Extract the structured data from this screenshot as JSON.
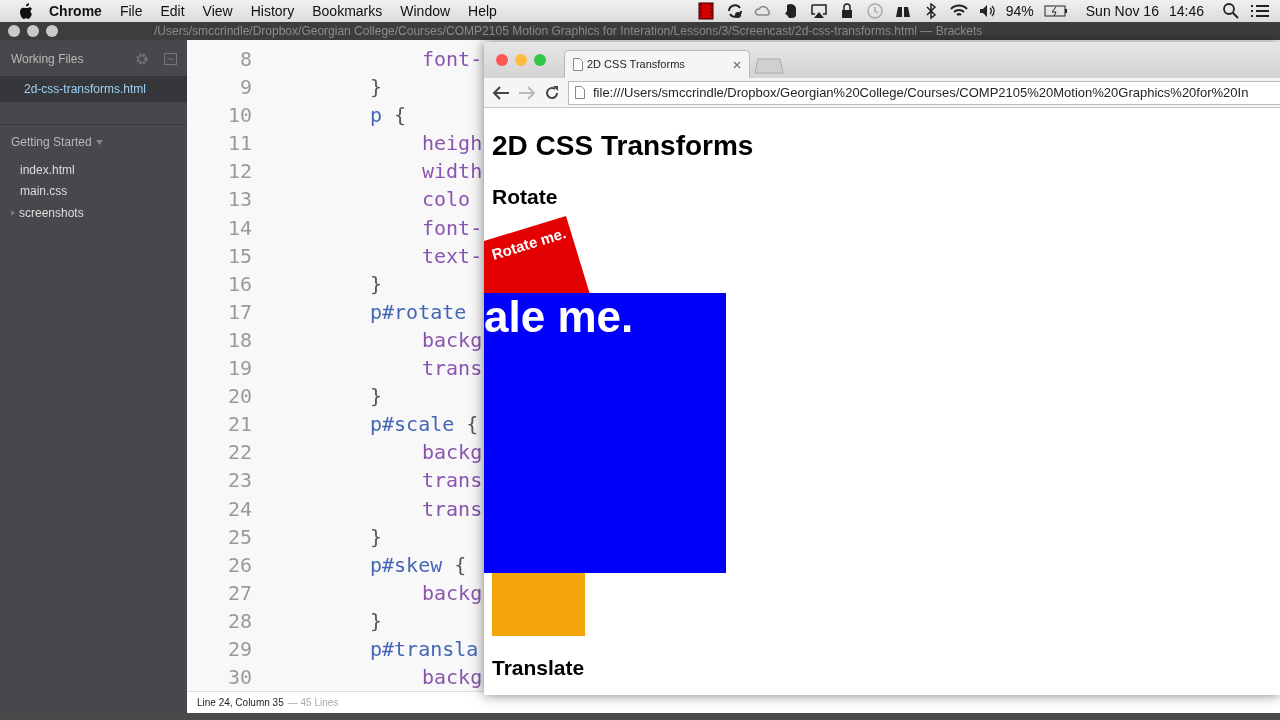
{
  "menu_bar": {
    "app": "Chrome",
    "items": [
      "File",
      "Edit",
      "View",
      "History",
      "Bookmarks",
      "Window",
      "Help"
    ],
    "battery": "94%",
    "date": "Sun Nov 16",
    "time": "14:46"
  },
  "editor_window": {
    "title": "/Users/smccrindle/Dropbox/Georgian College/Courses/COMP2105 Motion Graphics for Interation/Lessons/3/Screencast/2d-css-transforms.html — Brackets",
    "sidebar": {
      "working_files_label": "Working Files",
      "working_files": [
        {
          "name": "2d-css-transforms.html",
          "selected": true
        }
      ],
      "project": "Getting Started",
      "project_files": [
        {
          "name": "index.html",
          "kind": "file"
        },
        {
          "name": "main.css",
          "kind": "file"
        },
        {
          "name": "screenshots",
          "kind": "folder"
        }
      ]
    },
    "code_lines": [
      {
        "number": "8",
        "kind": "declaration",
        "tokens": [
          {
            "kind": "property",
            "text": "font-"
          }
        ]
      },
      {
        "number": "9",
        "kind": "rule",
        "tokens": [
          {
            "kind": "brace",
            "text": "}"
          }
        ]
      },
      {
        "number": "10",
        "kind": "rule",
        "tokens": [
          {
            "kind": "selector",
            "text": "p"
          },
          {
            "kind": "brace",
            "text": " {"
          }
        ]
      },
      {
        "number": "11",
        "kind": "declaration",
        "tokens": [
          {
            "kind": "property",
            "text": "heigh"
          }
        ]
      },
      {
        "number": "12",
        "kind": "declaration",
        "tokens": [
          {
            "kind": "property",
            "text": "width"
          }
        ]
      },
      {
        "number": "13",
        "kind": "declaration",
        "tokens": [
          {
            "kind": "property",
            "text": "colo"
          }
        ]
      },
      {
        "number": "14",
        "kind": "declaration",
        "tokens": [
          {
            "kind": "property",
            "text": "font-"
          }
        ]
      },
      {
        "number": "15",
        "kind": "declaration",
        "tokens": [
          {
            "kind": "property",
            "text": "text-"
          }
        ]
      },
      {
        "number": "16",
        "kind": "rule",
        "tokens": [
          {
            "kind": "brace",
            "text": "}"
          }
        ]
      },
      {
        "number": "17",
        "kind": "rule",
        "tokens": [
          {
            "kind": "selector",
            "text": "p#rotate"
          }
        ]
      },
      {
        "number": "18",
        "kind": "declaration",
        "tokens": [
          {
            "kind": "property",
            "text": "backg"
          }
        ]
      },
      {
        "number": "19",
        "kind": "declaration",
        "tokens": [
          {
            "kind": "property",
            "text": "trans"
          }
        ]
      },
      {
        "number": "20",
        "kind": "rule",
        "tokens": [
          {
            "kind": "brace",
            "text": "}"
          }
        ]
      },
      {
        "number": "21",
        "kind": "rule",
        "tokens": [
          {
            "kind": "selector",
            "text": "p#scale"
          },
          {
            "kind": "brace",
            "text": " {"
          }
        ]
      },
      {
        "number": "22",
        "kind": "declaration",
        "tokens": [
          {
            "kind": "property",
            "text": "backg"
          }
        ]
      },
      {
        "number": "23",
        "kind": "declaration",
        "tokens": [
          {
            "kind": "property",
            "text": "trans"
          }
        ]
      },
      {
        "number": "24",
        "kind": "declaration",
        "tokens": [
          {
            "kind": "property",
            "text": "trans"
          }
        ]
      },
      {
        "number": "25",
        "kind": "rule",
        "tokens": [
          {
            "kind": "brace",
            "text": "}"
          }
        ]
      },
      {
        "number": "26",
        "kind": "rule",
        "tokens": [
          {
            "kind": "selector",
            "text": "p#skew"
          },
          {
            "kind": "brace",
            "text": " {"
          }
        ]
      },
      {
        "number": "27",
        "kind": "declaration",
        "tokens": [
          {
            "kind": "property",
            "text": "backg"
          }
        ]
      },
      {
        "number": "28",
        "kind": "rule",
        "tokens": [
          {
            "kind": "brace",
            "text": "}"
          }
        ]
      },
      {
        "number": "29",
        "kind": "rule",
        "tokens": [
          {
            "kind": "selector",
            "text": "p#transla"
          }
        ]
      },
      {
        "number": "30",
        "kind": "declaration",
        "tokens": [
          {
            "kind": "property",
            "text": "backg"
          }
        ]
      }
    ],
    "status": {
      "position": "Line 24, Column 35",
      "line_count": "— 45 Lines"
    }
  },
  "browser": {
    "tabs": [
      {
        "title": "2D CSS Transforms",
        "selected": true
      }
    ],
    "url": "file:///Users/smccrindle/Dropbox/Georgian%20College/Courses/COMP2105%20Motion%20Graphics%20for%20In",
    "page": {
      "heading": "2D CSS Transforms",
      "rotate_label": "Rotate",
      "rotate_box": "Rotate me.",
      "scale_box": "ale me.",
      "translate_label": "Translate"
    }
  }
}
